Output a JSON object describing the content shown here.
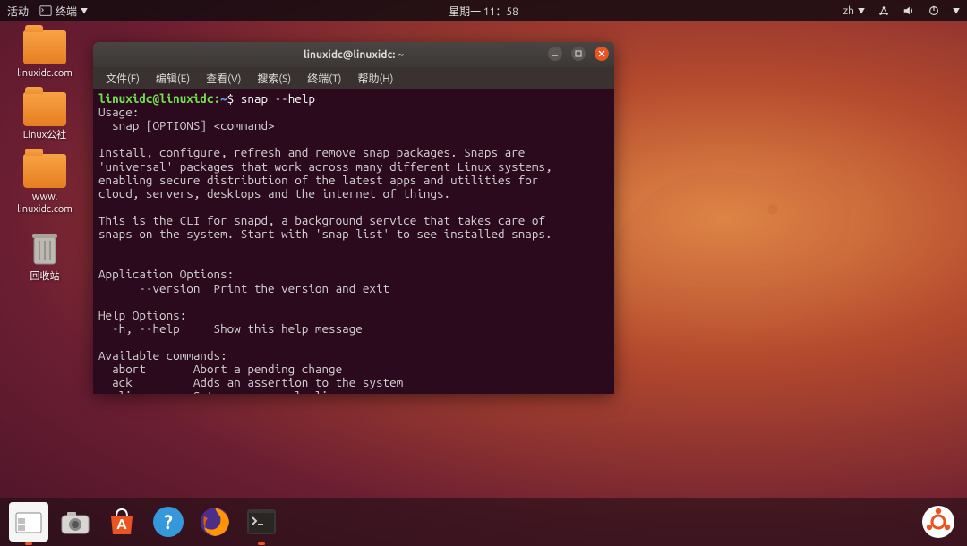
{
  "topbar": {
    "activities": "活动",
    "app_menu": "终端",
    "clock": "星期一 11：58",
    "input_method": "zh"
  },
  "desktop": {
    "icons": [
      {
        "label": "linuxidc.com",
        "type": "folder"
      },
      {
        "label": "Linux公社",
        "type": "folder"
      },
      {
        "label": "www.\nlinuxidc.com",
        "type": "folder"
      },
      {
        "label": "回收站",
        "type": "trash"
      }
    ]
  },
  "terminal": {
    "title": "linuxidc@linuxidc: ~",
    "menus": [
      "文件(F)",
      "编辑(E)",
      "查看(V)",
      "搜索(S)",
      "终端(T)",
      "帮助(H)"
    ],
    "prompt_user": "linuxidc@linuxidc",
    "prompt_path": "~",
    "command": "snap --help",
    "output": "Usage:\n  snap [OPTIONS] <command>\n\nInstall, configure, refresh and remove snap packages. Snaps are\n'universal' packages that work across many different Linux systems,\nenabling secure distribution of the latest apps and utilities for\ncloud, servers, desktops and the internet of things.\n\nThis is the CLI for snapd, a background service that takes care of\nsnaps on the system. Start with 'snap list' to see installed snaps.\n\n\nApplication Options:\n      --version  Print the version and exit\n\nHelp Options:\n  -h, --help     Show this help message\n\nAvailable commands:\n  abort       Abort a pending change\n  ack         Adds an assertion to the system\n  alias       Sets up a manual alias\n  aliases     Lists aliases in the system"
  },
  "dock": {
    "items": [
      {
        "name": "file-manager",
        "active": true
      },
      {
        "name": "screenshot",
        "active": false
      },
      {
        "name": "ubuntu-software",
        "active": false
      },
      {
        "name": "help",
        "active": false
      },
      {
        "name": "firefox",
        "active": false
      },
      {
        "name": "terminal",
        "active": true
      }
    ]
  }
}
